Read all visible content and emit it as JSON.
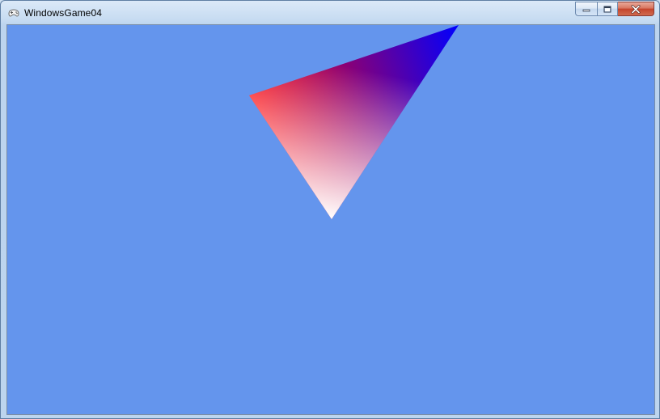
{
  "window": {
    "title": "WindowsGame04",
    "client_background": "#6495ED"
  },
  "caption_buttons": {
    "minimize": "minimize-icon",
    "maximize": "maximize-icon",
    "close": "close-icon"
  },
  "scene": {
    "shape": "triangle",
    "vertex_colors": [
      "#FF0000",
      "#0000FF",
      "#FFFFFF"
    ]
  }
}
